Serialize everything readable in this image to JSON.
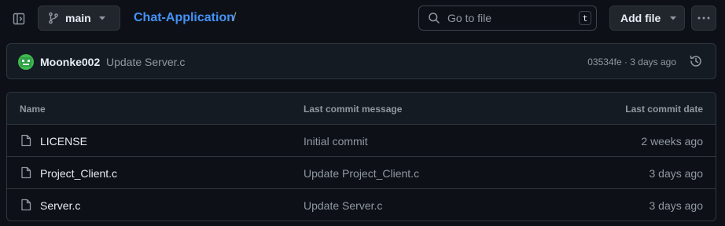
{
  "toolbar": {
    "branch": "main",
    "repo_name": "Chat-Application",
    "path_separator": "/",
    "search_placeholder": "Go to file",
    "search_shortcut": "t",
    "add_file_label": "Add file"
  },
  "latest_commit": {
    "author": "Moonke002",
    "message": "Update Server.c",
    "meta": "03534fe · 3 days ago"
  },
  "table": {
    "headers": {
      "name": "Name",
      "message": "Last commit message",
      "date": "Last commit date"
    },
    "files": [
      {
        "name": "LICENSE",
        "message": "Initial commit",
        "date": "2 weeks ago"
      },
      {
        "name": "Project_Client.c",
        "message": "Update Project_Client.c",
        "date": "3 days ago"
      },
      {
        "name": "Server.c",
        "message": "Update Server.c",
        "date": "3 days ago"
      }
    ]
  },
  "colors": {
    "background": "#0d1117",
    "link": "#4493f8",
    "muted": "#9198a1",
    "border": "#30363d",
    "avatar": "#3fb950"
  },
  "icons": {
    "sidebar_toggle": "sidebar-collapse-icon",
    "branch": "git-branch-icon",
    "search": "search-icon",
    "more": "kebab-horizontal-icon",
    "history": "history-icon",
    "file": "file-icon"
  }
}
